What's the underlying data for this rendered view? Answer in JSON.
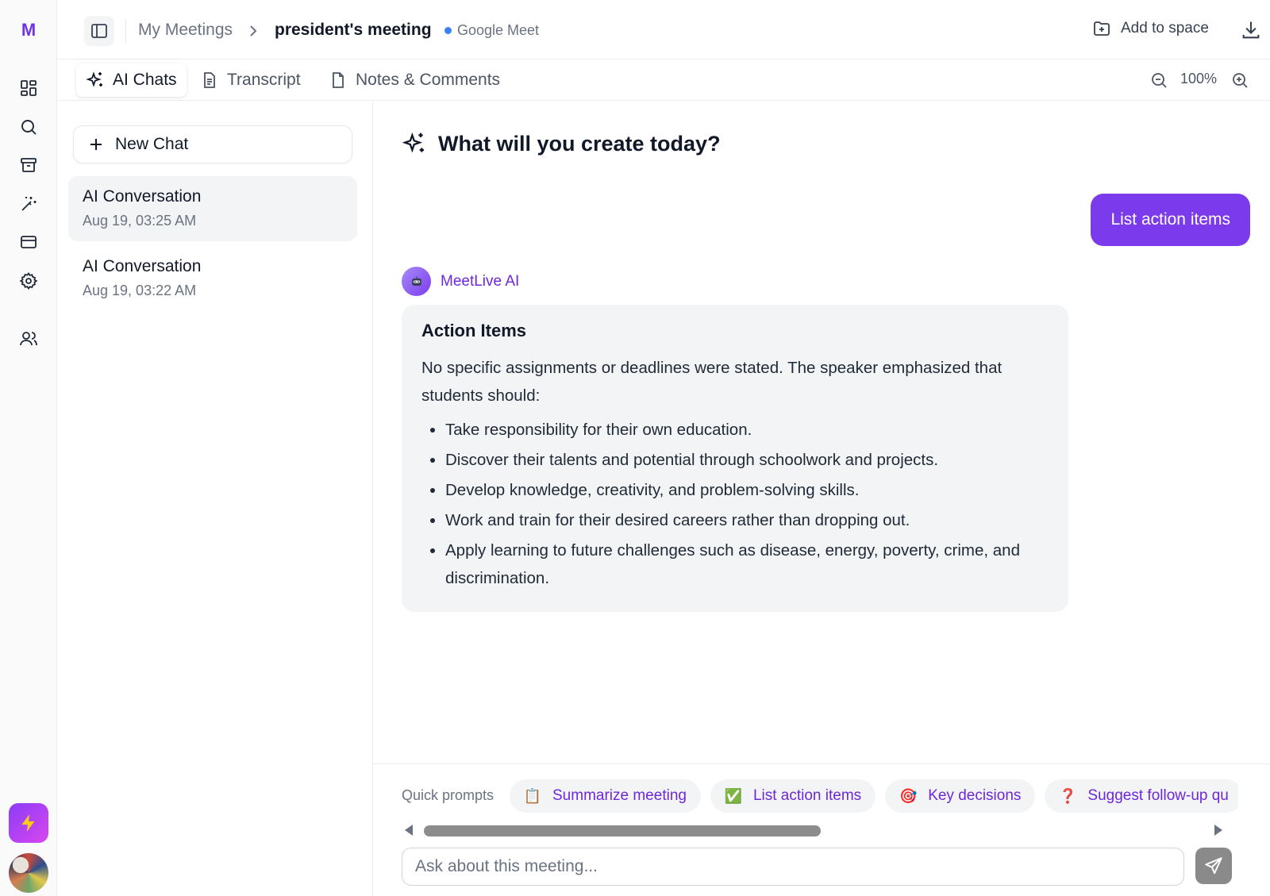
{
  "app": {
    "logo": "M",
    "logo_color": "#6d35e8",
    "accent": "#7c3aed"
  },
  "rail": {
    "items": [
      {
        "icon": "grid-icon"
      },
      {
        "icon": "search-icon"
      },
      {
        "icon": "archive-icon"
      },
      {
        "icon": "magic-wand-icon"
      },
      {
        "icon": "credit-card-icon"
      },
      {
        "icon": "gear-icon"
      },
      {
        "icon": "users-icon"
      }
    ]
  },
  "header": {
    "breadcrumb_root": "My Meetings",
    "meeting_title": "president's meeting",
    "platform": "Google Meet",
    "add_to_space": "Add to space"
  },
  "tabs": [
    {
      "label": "AI Chats",
      "icon": "sparkles-icon",
      "active": true
    },
    {
      "label": "Transcript",
      "icon": "document-icon",
      "active": false
    },
    {
      "label": "Notes & Comments",
      "icon": "file-icon",
      "active": false
    }
  ],
  "zoom": {
    "level": "100%"
  },
  "sidebar": {
    "new_chat_label": "New Chat",
    "conversations": [
      {
        "title": "AI Conversation",
        "date": "Aug 19, 03:25 AM",
        "selected": true
      },
      {
        "title": "AI Conversation",
        "date": "Aug 19, 03:22 AM",
        "selected": false
      }
    ]
  },
  "chat": {
    "hero_title": "What will you create today?",
    "user_message": "List action items",
    "assistant_name": "MeetLive AI",
    "response": {
      "heading": "Action Items",
      "intro": "No specific assignments or deadlines were stated. The speaker emphasized that students should:",
      "items": [
        "Take responsibility for their own education.",
        "Discover their talents and potential through schoolwork and projects.",
        "Develop knowledge, creativity, and problem-solving skills.",
        "Work and train for their desired careers rather than dropping out.",
        "Apply learning to future challenges such as disease, energy, poverty, crime, and discrimination."
      ]
    }
  },
  "composer": {
    "quick_prompts_label": "Quick prompts",
    "prompts": [
      {
        "emoji": "📋",
        "label": "Summarize meeting"
      },
      {
        "emoji": "✅",
        "label": "List action items"
      },
      {
        "emoji": "🎯",
        "label": "Key decisions"
      },
      {
        "emoji": "❓",
        "label": "Suggest follow-up qu"
      }
    ],
    "input_placeholder": "Ask about this meeting..."
  }
}
